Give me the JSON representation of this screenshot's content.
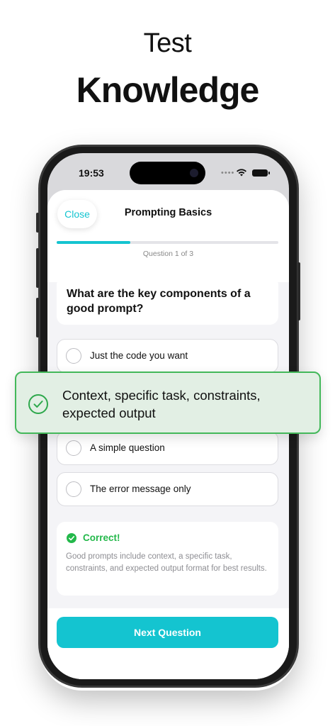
{
  "promo": {
    "line1": "Test",
    "line2": "Knowledge"
  },
  "status_bar": {
    "time": "19:53"
  },
  "quiz": {
    "close_label": "Close",
    "title": "Prompting Basics",
    "progress_text": "Question 1 of 3",
    "progress_value": 0.333,
    "question": "What are the key components of a good prompt?",
    "options": [
      {
        "label": "Just the code you want"
      },
      {
        "label": "A simple question"
      },
      {
        "label": "The error message only"
      }
    ],
    "selected_answer": "Context, specific task, constraints, expected output",
    "feedback_title": "Correct!",
    "feedback_body": "Good prompts include context, a specific task, constraints, and expected output format for best results.",
    "next_label": "Next Question"
  },
  "colors": {
    "accent": "#14c4d0",
    "success": "#23b84a",
    "callout_bg": "#e2efe4",
    "callout_border": "#43b85a"
  },
  "icons": {
    "feedback": "check-circle-filled-icon",
    "callout": "check-circle-outline-icon",
    "wifi": "wifi-icon",
    "battery": "battery-icon"
  }
}
